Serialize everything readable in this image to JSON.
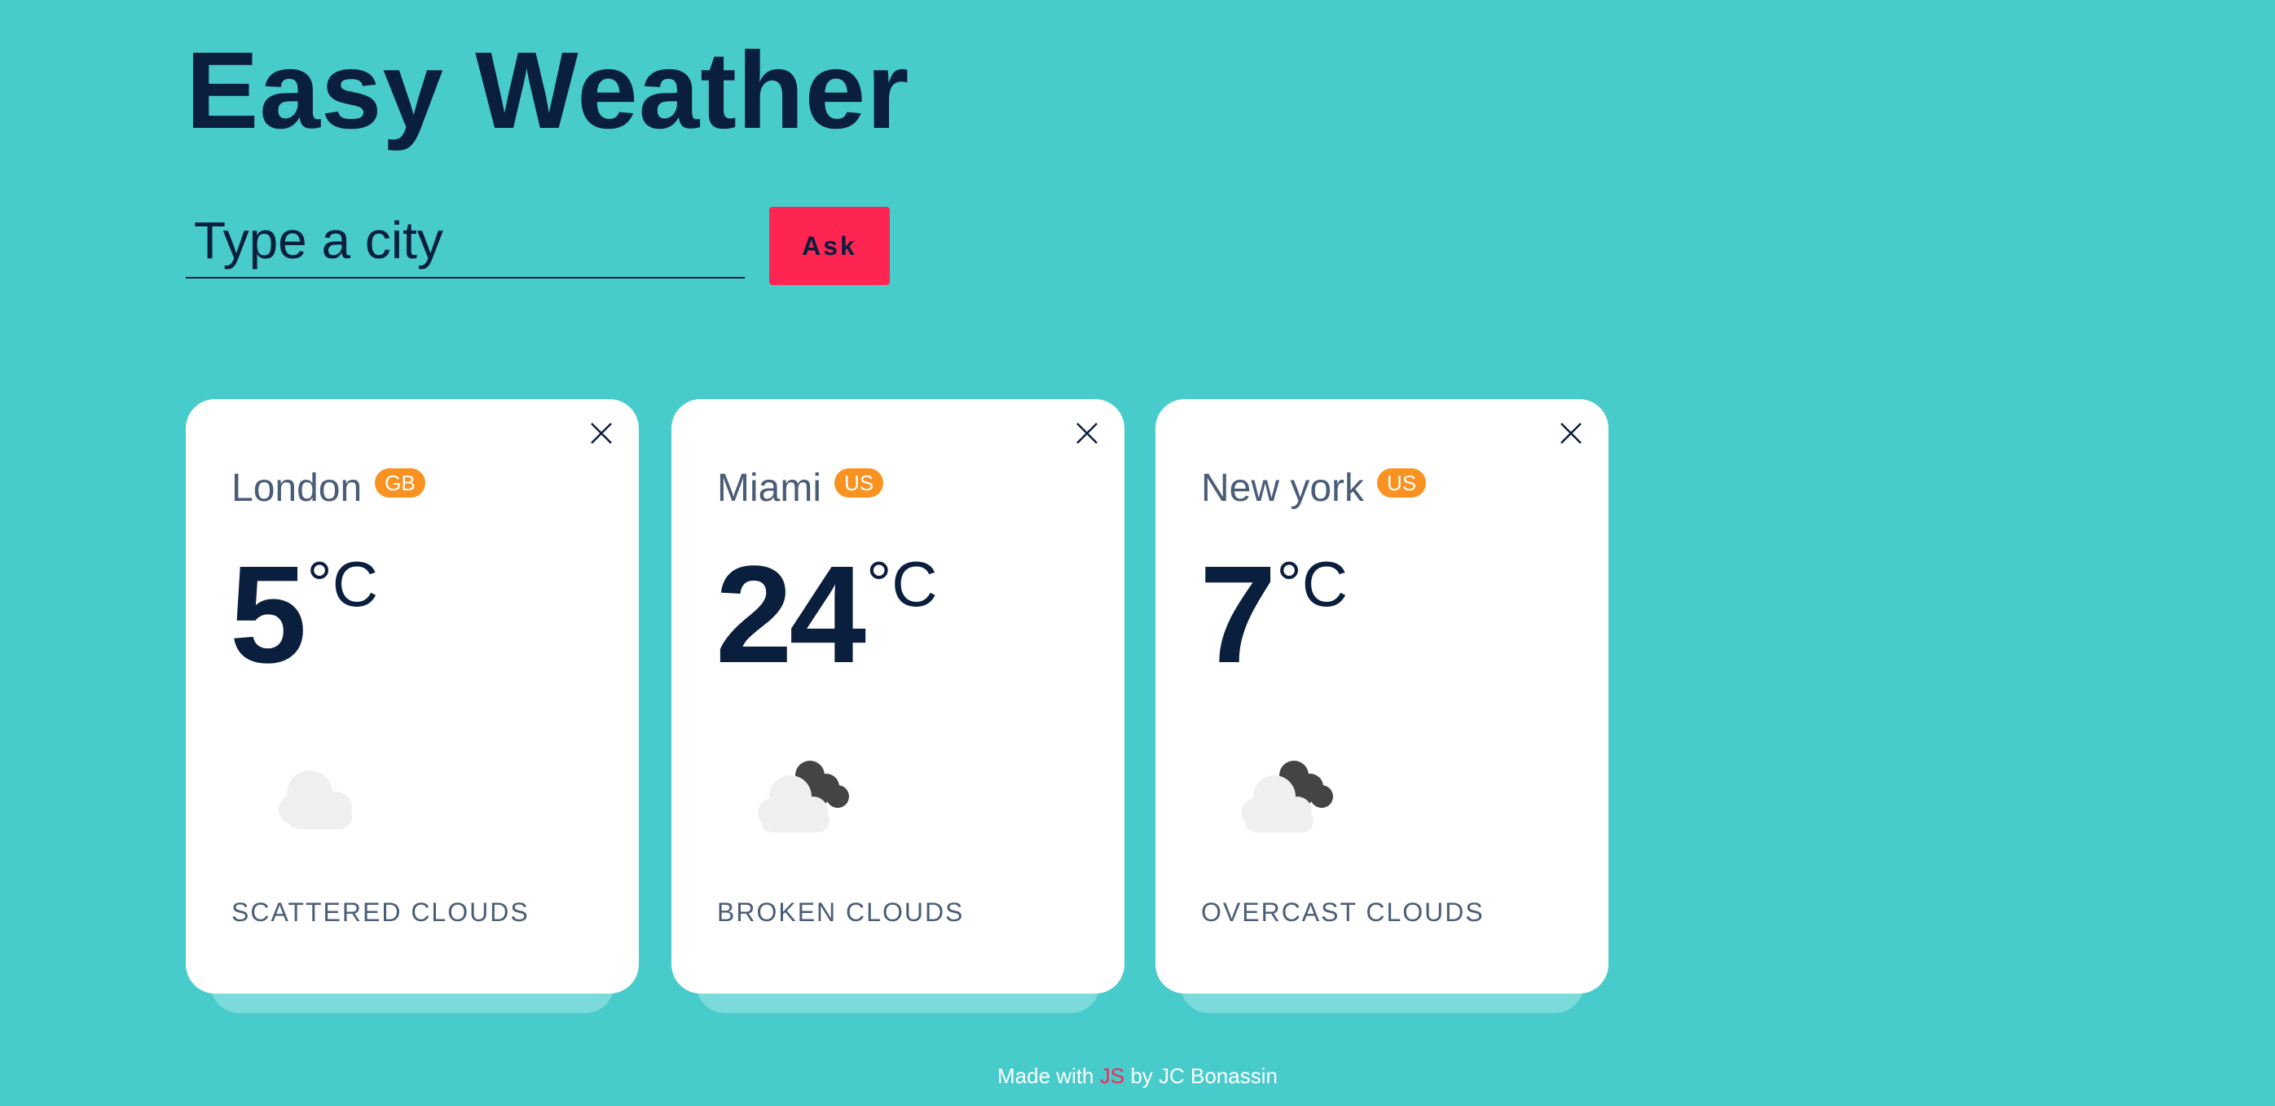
{
  "app": {
    "title": "Easy Weather"
  },
  "search": {
    "placeholder": "Type a city",
    "value": "",
    "button_label": "Ask"
  },
  "cards": [
    {
      "city": "London",
      "country": "GB",
      "temp": "5",
      "unit": "°C",
      "description": "Scattered clouds",
      "icon": "scattered-clouds-icon"
    },
    {
      "city": "Miami",
      "country": "US",
      "temp": "24",
      "unit": "°C",
      "description": "Broken clouds",
      "icon": "broken-clouds-icon"
    },
    {
      "city": "New york",
      "country": "US",
      "temp": "7",
      "unit": "°C",
      "description": "Overcast clouds",
      "icon": "overcast-clouds-icon"
    }
  ],
  "footer": {
    "prefix": "Made with ",
    "highlight": "JS",
    "suffix": " by JC Bonassin"
  },
  "colors": {
    "background": "#47cbcb",
    "accent": "#fe2553",
    "badge": "#f99220",
    "text_dark": "#0a1f3d",
    "text_muted": "#4a5d78"
  }
}
